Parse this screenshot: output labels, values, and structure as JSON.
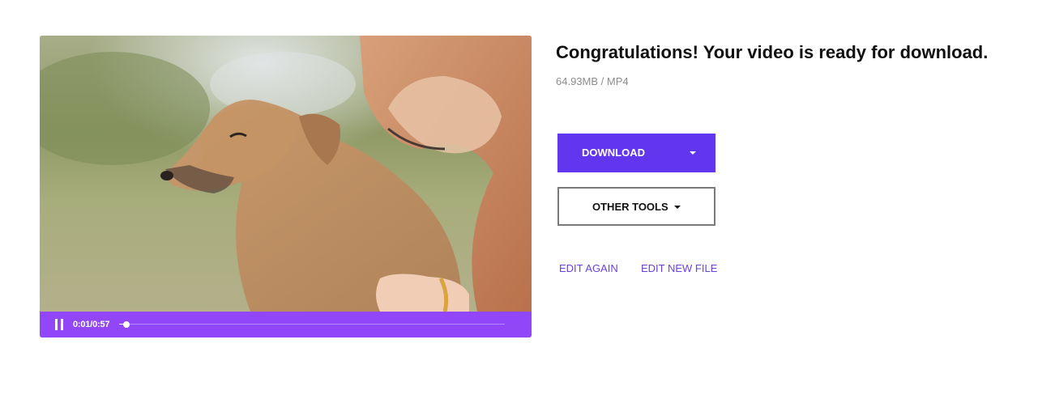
{
  "player": {
    "time_display": "0:01/0:57",
    "progress_fraction": 0.018,
    "controls_color": "#9146f7",
    "frame_subject": "dog-and-woman-video-frame"
  },
  "result": {
    "title": "Congratulations! Your video is ready for download.",
    "file_info": "64.93MB / MP4"
  },
  "actions": {
    "download_label": "DOWNLOAD",
    "download_color": "#6236ef",
    "other_tools_label": "OTHER TOOLS",
    "edit_again_label": "EDIT AGAIN",
    "edit_new_file_label": "EDIT NEW FILE",
    "link_color": "#6a42d8"
  },
  "icons": {
    "pause": "pause-icon",
    "download_dropdown": "chevron-down-icon",
    "tools_dropdown": "chevron-down-icon"
  }
}
